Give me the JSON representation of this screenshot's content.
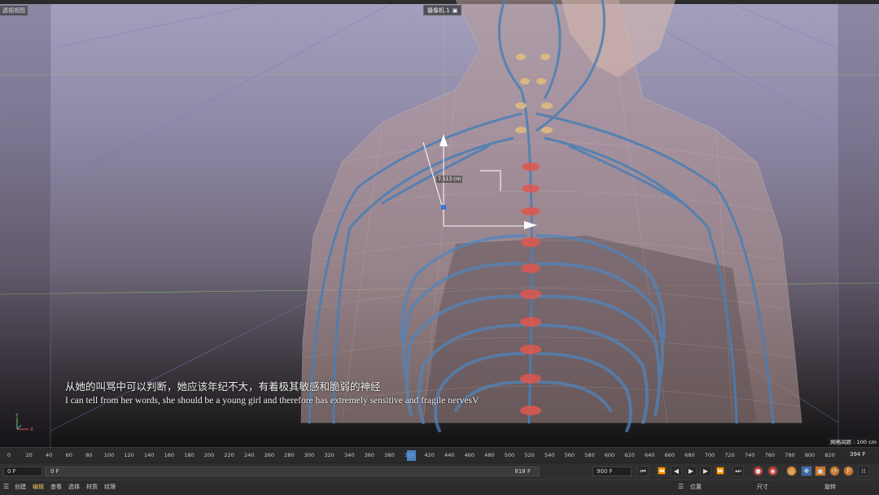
{
  "viewport": {
    "label": "透视视图",
    "camera_label": "摄像机.1",
    "camera_icon": "camera-icon",
    "measure_value": "7.513 cm",
    "grid_spacing": "网格间距 : 100 cm"
  },
  "subtitle": {
    "chinese": "从她的叫骂中可以判断，她应该年纪不大，有着极其敏感和脆弱的神经",
    "english": "I can tell from her words, she should be a young girl and therefore has extremely sensitive and fragile nervesV"
  },
  "axis_gizmo": {
    "x_label": "X",
    "y_label": "Y"
  },
  "timeline": {
    "ticks": [
      "0",
      "20",
      "40",
      "60",
      "80",
      "100",
      "120",
      "140",
      "160",
      "180",
      "200",
      "220",
      "240",
      "260",
      "280",
      "300",
      "320",
      "340",
      "360",
      "380",
      "394",
      "420",
      "440",
      "460",
      "480",
      "500",
      "520",
      "540",
      "560",
      "580",
      "600",
      "620",
      "640",
      "660",
      "680",
      "700",
      "720",
      "740",
      "760",
      "780",
      "800",
      "820"
    ],
    "current_frame": "394",
    "end_frame_label": "394 F"
  },
  "transport": {
    "start_field": "0 F",
    "range_start": "0 F",
    "range_end": "818 F",
    "max_field": "900 F",
    "buttons": [
      "go-to-start-icon",
      "prev-key-icon",
      "prev-frame-icon",
      "play-icon",
      "next-frame-icon",
      "next-key-icon",
      "go-to-end-icon",
      "record-icon",
      "auto-key-icon",
      "keyframe-icon",
      "move-icon",
      "scale-icon",
      "rotate-icon",
      "param-icon",
      "grid-icon"
    ]
  },
  "menubar": {
    "items": [
      "创建",
      "编辑",
      "查看",
      "选择",
      "材质",
      "纹理"
    ],
    "active_index": 1,
    "coord_headers": [
      "位置",
      "尺寸",
      "旋转"
    ]
  },
  "colors": {
    "accent": "#f0c45a",
    "nerve_blue": "#4a7fb5",
    "spine_red": "#e0574e",
    "playhead": "#4d7fbf"
  }
}
